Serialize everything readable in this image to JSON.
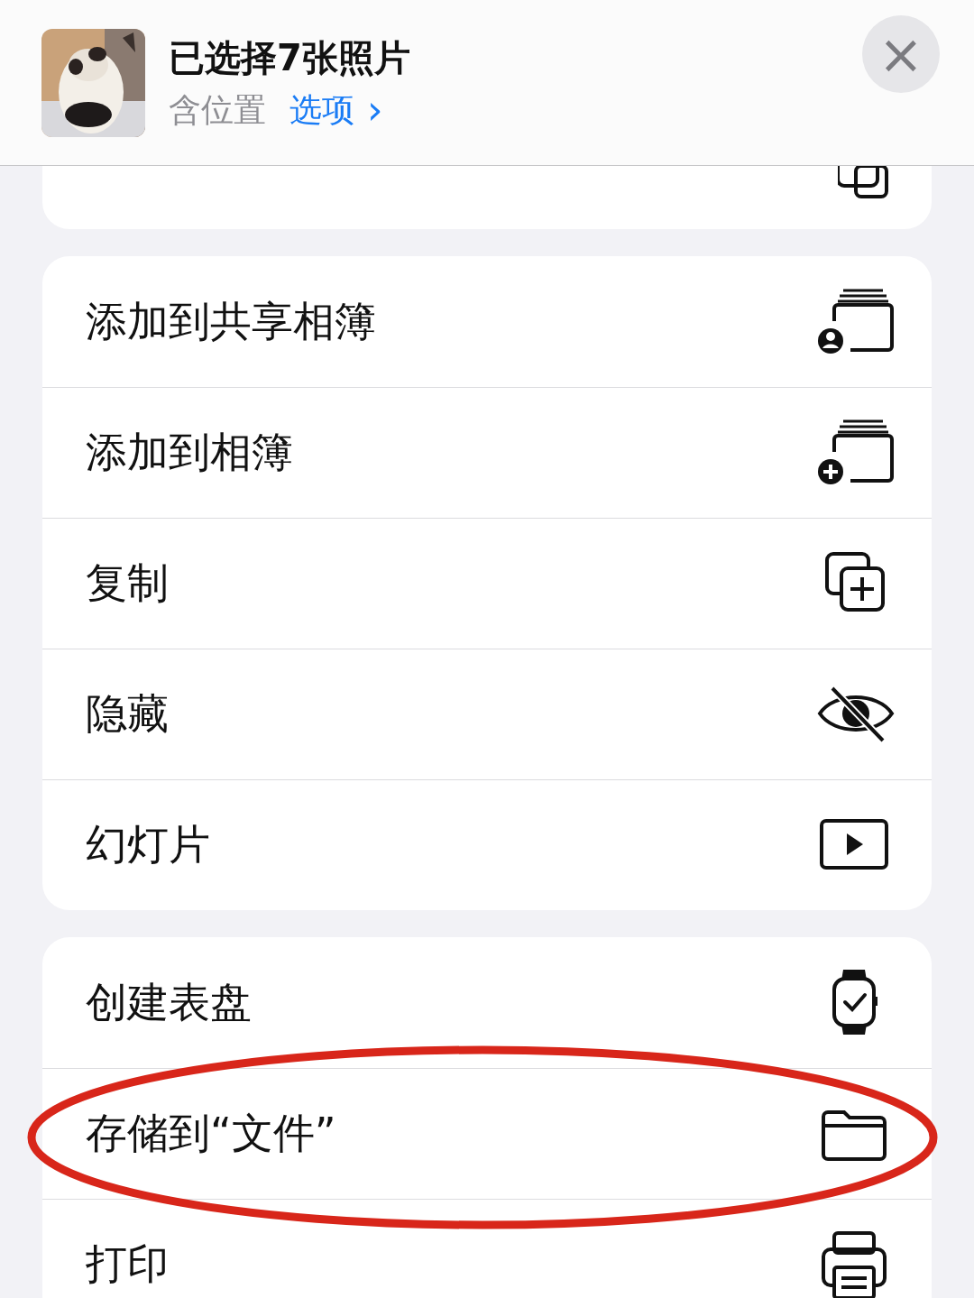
{
  "header": {
    "title": "已选择7张照片",
    "subtitle": "含位置",
    "options_link": "选项",
    "options_chevron": "›",
    "close": "×"
  },
  "groups": [
    {
      "kind": "clipped",
      "items": [
        {
          "circled": false
        }
      ]
    },
    {
      "items": [
        {
          "label": "添加到共享相簿",
          "circled": false
        },
        {
          "label": "添加到相簿",
          "circled": false
        },
        {
          "label": "复制",
          "circled": false
        },
        {
          "label": "隐藏",
          "circled": false
        },
        {
          "label": "幻灯片",
          "circled": false
        }
      ]
    },
    {
      "items": [
        {
          "label": "创建表盘",
          "circled": false
        },
        {
          "label": "存储到“文件”",
          "circled": true
        },
        {
          "label": "打印",
          "circled": false
        }
      ]
    }
  ]
}
